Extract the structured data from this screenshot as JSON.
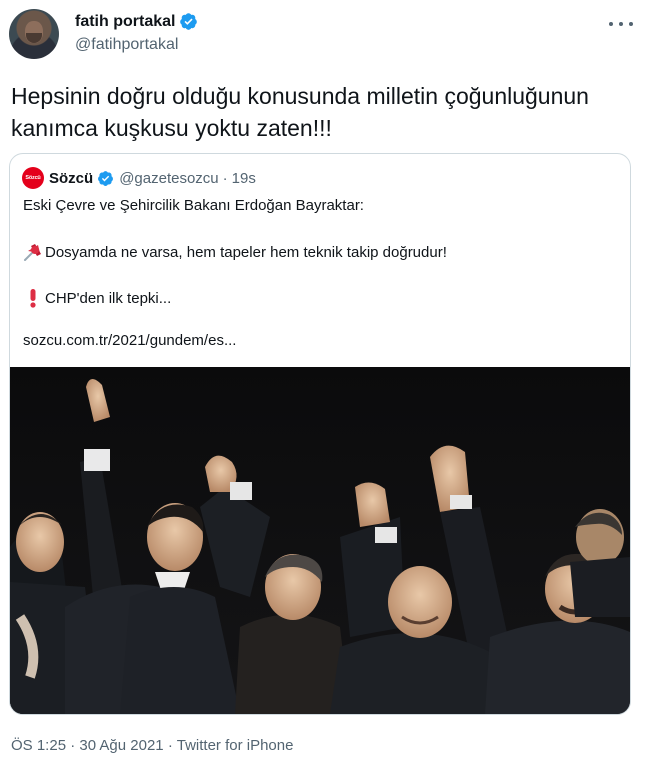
{
  "tweet": {
    "author": {
      "name": "fatih portakal",
      "handle": "@fatihportakal",
      "verified": true
    },
    "text": "Hepsinin doğru olduğu konusunda milletin çoğunluğunun kanımca kuşkusu yoktu zaten!!!",
    "more_icon": "more-horizontal-icon",
    "meta": {
      "time": "ÖS 1:25",
      "date": "30 Ağu 2021",
      "source": "Twitter for iPhone",
      "separator": "·"
    }
  },
  "quoted": {
    "logo_text": "Sözcü",
    "name": "Sözcü",
    "handle": "@gazetesozcu",
    "separator": "·",
    "time": "19s",
    "lines": [
      "Eski Çevre ve Şehircilik Bakanı Erdoğan Bayraktar:",
      "Dosyamda ne varsa, hem tapeler hem teknik takip doğrudur!",
      "CHP'den ilk tepki...",
      "sozcu.com.tr/2021/gundem/es..."
    ],
    "icons": {
      "line2": "pushpin-icon",
      "line3": "exclamation-icon"
    }
  },
  "colors": {
    "text": "#0f1419",
    "secondary": "#536471",
    "verified": "#1d9bf0",
    "border": "#cfd9de",
    "brand": "#e4001b"
  }
}
